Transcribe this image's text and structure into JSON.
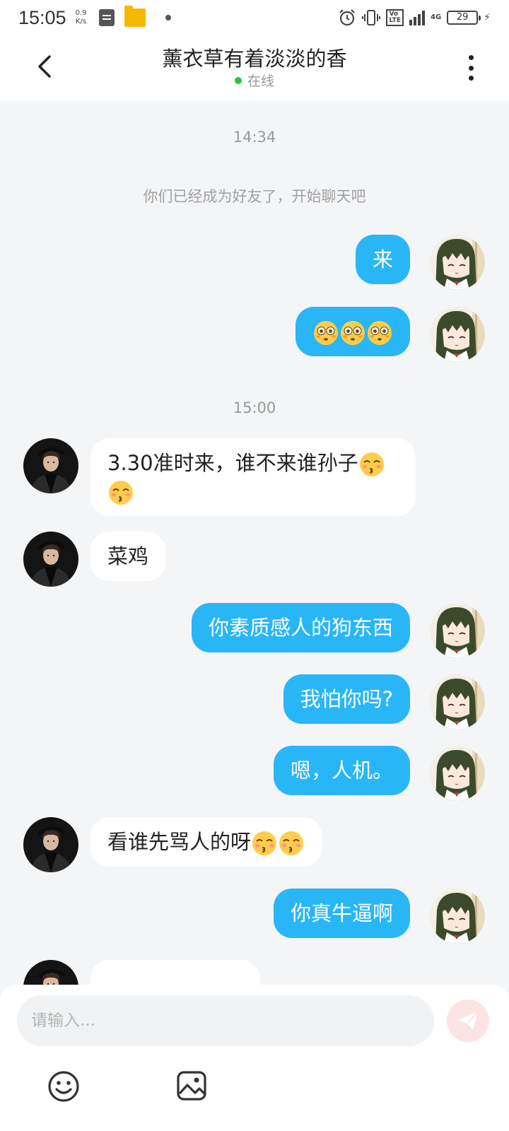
{
  "status_bar": {
    "time": "15:05",
    "net_speed_value": "0.9",
    "net_speed_unit": "K/s",
    "network": "4G",
    "battery": "29",
    "icons": [
      "note-icon",
      "folder-icon",
      "alarm-icon",
      "vibrate-icon",
      "volte-icon",
      "signal-icon",
      "battery-icon",
      "charging-icon"
    ]
  },
  "header": {
    "title": "薰衣草有着淡淡的香",
    "status": "在线",
    "status_color": "#2fc04a"
  },
  "chat": {
    "timestamps": [
      "14:34",
      "15:00"
    ],
    "system_message": "你们已经成为好友了，开始聊天吧",
    "messages": [
      {
        "from": "me",
        "text": "来"
      },
      {
        "from": "me",
        "text": "",
        "emojis": [
          "flushed-face",
          "flushed-face",
          "flushed-face"
        ]
      },
      {
        "from": "other",
        "line1": "3.30准时来，谁不来谁孙子",
        "emojis": [
          "kissing-face",
          "kissing-face"
        ]
      },
      {
        "from": "other",
        "text": "菜鸡"
      },
      {
        "from": "me",
        "text": "你素质感人的狗东西"
      },
      {
        "from": "me",
        "text": "我怕你吗?"
      },
      {
        "from": "me",
        "text": "嗯，人机。"
      },
      {
        "from": "other",
        "text": "看谁先骂人的呀",
        "emojis": [
          "kissing-face",
          "kissing-face"
        ]
      },
      {
        "from": "me",
        "text": "你真牛逼啊"
      }
    ]
  },
  "input": {
    "placeholder": "请输入..."
  },
  "colors": {
    "my_bubble": "#29b6f6",
    "other_bubble": "#ffffff",
    "background": "#f4f5f7",
    "send_button": "#fde4e4"
  }
}
